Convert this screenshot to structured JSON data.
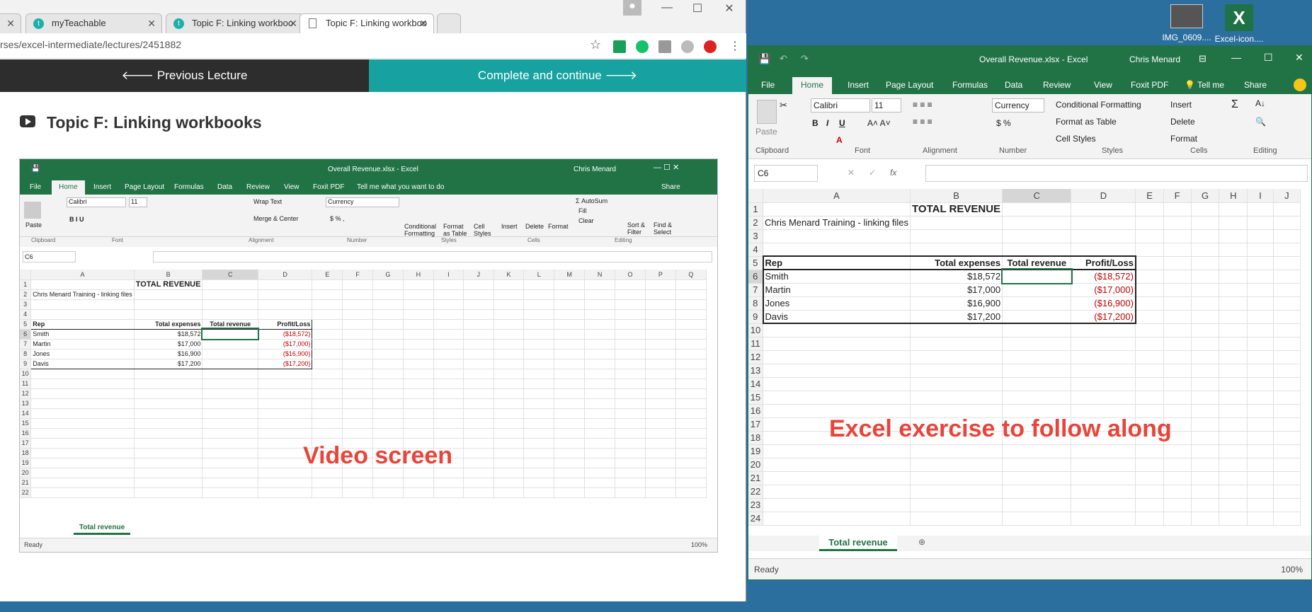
{
  "desktop": {
    "icons": [
      {
        "label": "IMG_0609...."
      },
      {
        "label": "Excel-icon...."
      }
    ]
  },
  "browser": {
    "tabs": [
      {
        "label": "myTeachable"
      },
      {
        "label": "Topic F: Linking workboo"
      },
      {
        "label": "Topic F: Linking workboo"
      }
    ],
    "url": "rses/excel-intermediate/lectures/2451882",
    "nav": {
      "prev": "Previous Lecture",
      "next": "Complete and continue"
    },
    "lecture_title": "Topic F: Linking workbooks"
  },
  "video": {
    "title": "Overall Revenue.xlsx - Excel",
    "user": "Chris Menard",
    "ribbon_tabs": [
      "File",
      "Home",
      "Insert",
      "Page Layout",
      "Formulas",
      "Data",
      "Review",
      "View",
      "Foxit PDF",
      "Tell me what you want to do"
    ],
    "share": "Share",
    "font": "Calibri",
    "font_size": "11",
    "number_format": "Currency",
    "wrap_text": "Wrap Text",
    "merge_center": "Merge & Center",
    "autosum": "AutoSum",
    "fill": "Fill",
    "clear": "Clear",
    "groups": [
      "Clipboard",
      "Font",
      "Alignment",
      "Number",
      "Styles",
      "Cells",
      "Editing"
    ],
    "style_buttons": [
      "Conditional Formatting",
      "Format as Table",
      "Cell Styles"
    ],
    "cell_buttons": [
      "Insert",
      "Delete",
      "Format"
    ],
    "edit_buttons": [
      "Sort & Filter",
      "Find & Select"
    ],
    "paste": "Paste",
    "namebox": "C6",
    "sheet_tab": "Total revenue",
    "status": "Ready",
    "zoom": "100%",
    "overlay": "Video screen"
  },
  "excel": {
    "title": "Overall Revenue.xlsx  -  Excel",
    "user": "Chris Menard",
    "ribbon_tabs": [
      "File",
      "Home",
      "Insert",
      "Page Layout",
      "Formulas",
      "Data",
      "Review",
      "View",
      "Foxit PDF",
      "Tell me",
      "Share"
    ],
    "font": "Calibri",
    "font_size": "11",
    "number_format": "Currency",
    "paste": "Paste",
    "groups": [
      "Clipboard",
      "Font",
      "Alignment",
      "Number",
      "Styles",
      "Cells",
      "Editing"
    ],
    "style_buttons": [
      "Conditional Formatting",
      "Format as Table",
      "Cell Styles"
    ],
    "cell_buttons": [
      "Insert",
      "Delete",
      "Format"
    ],
    "namebox": "C6",
    "sheet_tab": "Total revenue",
    "status": "Ready",
    "zoom": "100%",
    "overlay": "Excel exercise to follow along"
  },
  "sheet": {
    "columns_right": [
      "A",
      "B",
      "C",
      "D",
      "E",
      "F",
      "G",
      "H",
      "I",
      "J"
    ],
    "columns_video": [
      "A",
      "B",
      "C",
      "D",
      "E",
      "F",
      "G",
      "H",
      "I",
      "J",
      "K",
      "L",
      "M",
      "N",
      "O",
      "P",
      "Q"
    ],
    "title": "TOTAL REVENUE",
    "subtitle": "Chris Menard Training - linking files",
    "headers": [
      "Rep",
      "Total expenses",
      "Total revenue",
      "Profit/Loss"
    ],
    "rows": [
      {
        "rep": "Smith",
        "expenses": "$18,572",
        "revenue": "",
        "profit": "($18,572)"
      },
      {
        "rep": "Martin",
        "expenses": "$17,000",
        "revenue": "",
        "profit": "($17,000)"
      },
      {
        "rep": "Jones",
        "expenses": "$16,900",
        "revenue": "",
        "profit": "($16,900)"
      },
      {
        "rep": "Davis",
        "expenses": "$17,200",
        "revenue": "",
        "profit": "($17,200)"
      }
    ]
  },
  "colors": {
    "excel_green": "#217346",
    "teachable_teal": "#17a2a0",
    "dark_nav": "#2d2d2d",
    "accent_red": "#e8453a"
  }
}
